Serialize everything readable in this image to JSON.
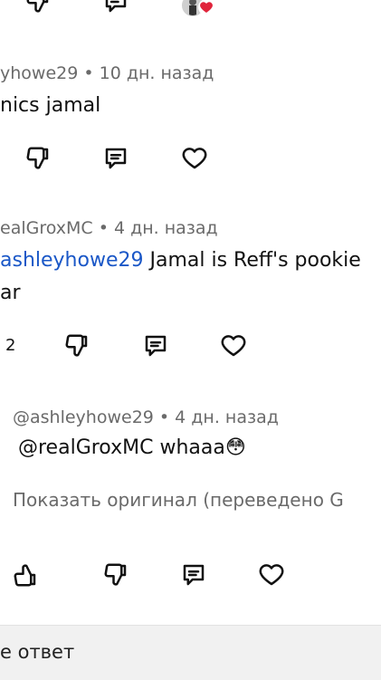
{
  "comments": [
    {
      "meta": "yhowe29 • 10 дн. назад",
      "text": "nics jamal"
    },
    {
      "meta": "ealGroxMC • 4 дн. назад",
      "mention": "ashleyhowe29",
      "text_after": "  Jamal is Reff's pookie",
      "text_line2": "ar",
      "like_count": "2"
    },
    {
      "meta": "@ashleyhowe29 • 4 дн. назад",
      "mention": "@realGroxMC",
      "text_after": " whaaa😳",
      "translate": "Показать оригинал (переведено G"
    }
  ],
  "reply_bar": {
    "placeholder": "е ответ"
  },
  "colors": {
    "mention": "#1a57c7",
    "heart_badge": "#e0243b",
    "meta": "#6a6a6a"
  },
  "icons": [
    "thumbs-down-icon",
    "comment-icon",
    "heart-icon",
    "thumbs-up-icon"
  ]
}
